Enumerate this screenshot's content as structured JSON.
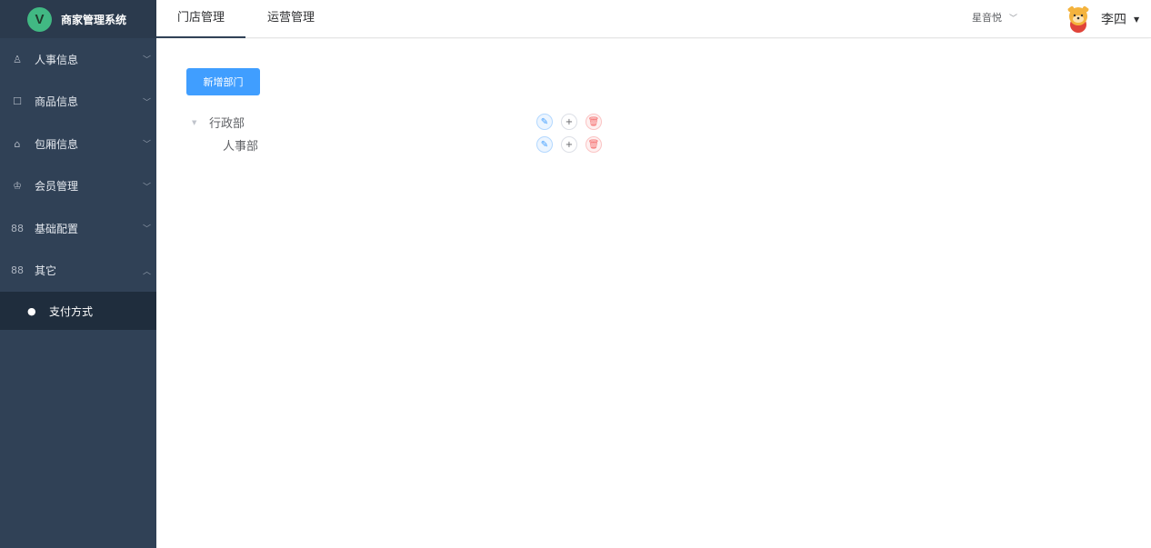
{
  "app": {
    "logo_letter": "V",
    "title": "商家管理系统"
  },
  "sidebar": {
    "items": [
      {
        "label": "人事信息",
        "icon": "user-icon"
      },
      {
        "label": "商品信息",
        "icon": "bag-icon"
      },
      {
        "label": "包厢信息",
        "icon": "home-icon"
      },
      {
        "label": "会员管理",
        "icon": "crown-icon"
      },
      {
        "label": "基础配置",
        "icon": "grid-icon"
      },
      {
        "label": "其它",
        "icon": "grid-icon"
      }
    ],
    "subitem": {
      "label": "支付方式",
      "icon": "money-bag-icon"
    }
  },
  "header": {
    "tabs": [
      {
        "label": "门店管理"
      },
      {
        "label": "运营管理"
      }
    ],
    "store": "星音悦",
    "user_name": "李四"
  },
  "main": {
    "add_button": "新增部门",
    "tree": [
      {
        "label": "行政部"
      },
      {
        "label": "人事部"
      }
    ]
  },
  "colors": {
    "sidebar_bg": "#304156",
    "primary": "#409eff",
    "danger": "#f56c6c"
  }
}
